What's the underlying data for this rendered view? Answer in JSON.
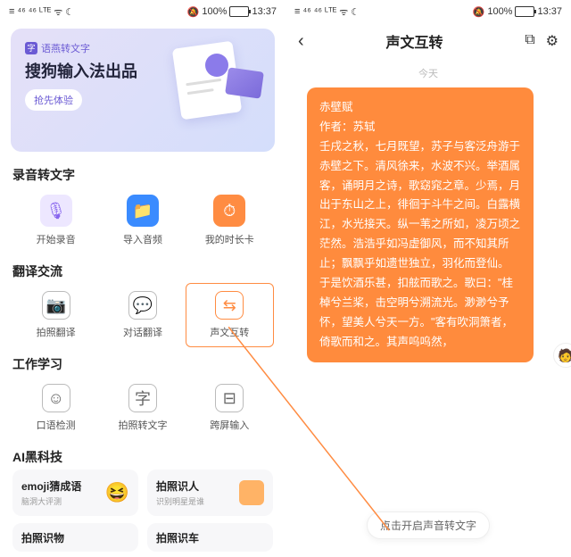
{
  "status": {
    "network": "≡ ⁴⁶ ⁴⁶ ᴸᵀᴱ",
    "wifi": "ᯤ",
    "moon": "☾",
    "mute": "🔕",
    "battery_text": "100%",
    "time": "13:37"
  },
  "banner": {
    "tag": "语燕转文字",
    "title": "搜狗输入法出品",
    "btn": "抢先体验"
  },
  "sections": {
    "audio": {
      "title": "录音转文字",
      "items": [
        {
          "label": "开始录音",
          "color": "#8866ee",
          "glyph": "🎤"
        },
        {
          "label": "导入音频",
          "color": "#3a8bff",
          "glyph": "📁"
        },
        {
          "label": "我的时长卡",
          "color": "#ff8c42",
          "glyph": "⏱"
        }
      ]
    },
    "trans": {
      "title": "翻译交流",
      "items": [
        {
          "label": "拍照翻译",
          "glyph": "⊡"
        },
        {
          "label": "对话翻译",
          "glyph": "⧉"
        },
        {
          "label": "声文互转",
          "glyph": "⇆",
          "hl": true
        }
      ]
    },
    "work": {
      "title": "工作学习",
      "items": [
        {
          "label": "口语检测",
          "glyph": "⊝"
        },
        {
          "label": "拍照转文字",
          "glyph": "字"
        },
        {
          "label": "跨屏输入",
          "glyph": "⊟"
        }
      ]
    },
    "ai": {
      "title": "AI黑科技",
      "cards": [
        {
          "t": "emoji猜成语",
          "s": "脑洞大评测",
          "emoji": "😆"
        },
        {
          "t": "拍照识人",
          "s": "识别明星是谁"
        }
      ],
      "partial": [
        "拍照识物",
        "拍照识车"
      ]
    }
  },
  "right": {
    "title": "声文互转",
    "day": "今天",
    "msg_title": "赤壁赋",
    "msg_author": "作者：苏轼",
    "msg_body": "壬戌之秋，七月既望，苏子与客泛舟游于赤壁之下。清风徐来，水波不兴。举酒属客，诵明月之诗，歌窈窕之章。少焉，月出于东山之上，徘徊于斗牛之间。白露横江，水光接天。纵一苇之所如，凌万顷之茫然。浩浩乎如冯虚御风，而不知其所止；飘飘乎如遗世独立，羽化而登仙。\n于是饮酒乐甚，扣舷而歌之。歌曰：\"桂棹兮兰桨，击空明兮溯流光。渺渺兮予怀，望美人兮天一方。\"客有吹洞箫者，倚歌而和之。其声呜呜然，",
    "hint": "点击开启声音转文字"
  }
}
